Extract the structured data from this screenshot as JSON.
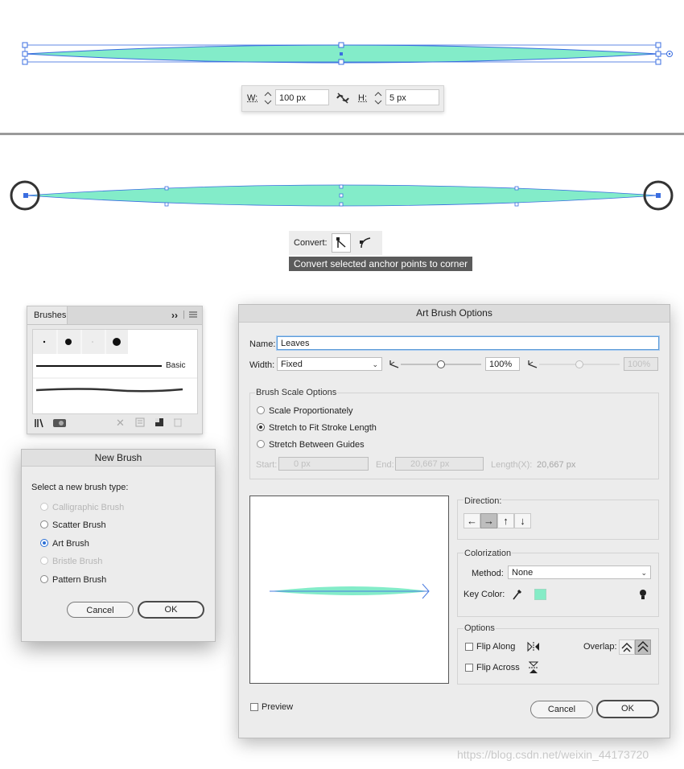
{
  "colors": {
    "stroke_fill": "#83ecc9",
    "selection": "#3a6de0",
    "key_color": "#84ecc6"
  },
  "transform": {
    "w_label": "W:",
    "w_value": "100 px",
    "h_label": "H:",
    "h_value": "5 px"
  },
  "convert": {
    "label": "Convert:",
    "tooltip": "Convert selected anchor points to corner"
  },
  "brushes_panel": {
    "tab": "Brushes",
    "basic_label": "Basic"
  },
  "new_brush": {
    "title": "New Brush",
    "prompt": "Select a new brush type:",
    "types": [
      {
        "label": "Calligraphic Brush",
        "state": "disabled"
      },
      {
        "label": "Scatter Brush",
        "state": "off"
      },
      {
        "label": "Art Brush",
        "state": "on"
      },
      {
        "label": "Bristle Brush",
        "state": "disabled"
      },
      {
        "label": "Pattern Brush",
        "state": "off"
      }
    ],
    "cancel": "Cancel",
    "ok": "OK"
  },
  "art_brush": {
    "title": "Art Brush Options",
    "name_label": "Name:",
    "name_value": "Leaves",
    "width_label": "Width:",
    "width_value": "Fixed",
    "width_pct": "100%",
    "width_pct_disabled": "100%",
    "scale_group": "Brush Scale Options",
    "scale_options": [
      {
        "label": "Scale Proportionately",
        "state": "off"
      },
      {
        "label": "Stretch to Fit Stroke Length",
        "state": "on"
      },
      {
        "label": "Stretch Between Guides",
        "state": "off"
      }
    ],
    "start_label": "Start:",
    "start_value": "0 px",
    "end_label": "End:",
    "end_value": "20,667 px",
    "length_label": "Length(X):",
    "length_value": "20,667 px",
    "direction_label": "Direction:",
    "colorization_label": "Colorization",
    "method_label": "Method:",
    "method_value": "None",
    "key_color_label": "Key Color:",
    "options_label": "Options",
    "flip_along": "Flip Along",
    "flip_across": "Flip Across",
    "overlap_label": "Overlap:",
    "preview_label": "Preview",
    "cancel": "Cancel",
    "ok": "OK"
  },
  "watermark": "https://blog.csdn.net/weixin_44173720"
}
